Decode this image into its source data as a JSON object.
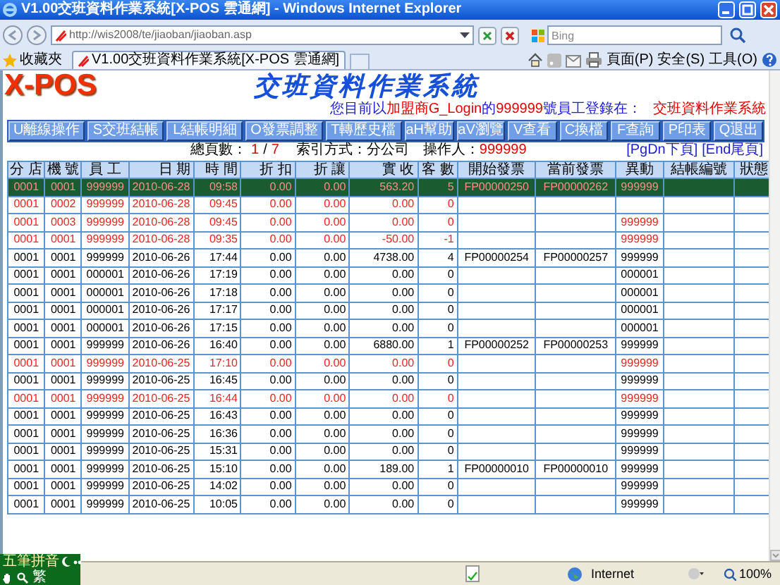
{
  "window": {
    "title": "V1.00交班資料作業系統[X-POS 雲通網] - Windows Internet Explorer"
  },
  "address_bar": {
    "url": "http://wis2008/te/jiaoban/jiaoban.asp",
    "search_placeholder": "Bing"
  },
  "favorites": {
    "label": "收藏夾"
  },
  "tab": {
    "title": "V1.00交班資料作業系統[X-POS 雲通網]",
    "selected": true
  },
  "command_bar": {
    "menus": [
      "頁面(P)",
      "安全(S)",
      "工具(O)"
    ]
  },
  "app": {
    "logo": "X-POS",
    "title": "交班資料作業系統",
    "login_notice": [
      {
        "text": "您目前以",
        "emphasis": false
      },
      {
        "text": "加盟商G_Login",
        "emphasis": true
      },
      {
        "text": "的",
        "emphasis": false
      },
      {
        "text": "999999",
        "emphasis": true
      },
      {
        "text": "號員工登錄在：",
        "emphasis": false
      }
    ],
    "current_system": "交班資料作業系統",
    "buttons": [
      "U離線操作",
      "S交班結帳",
      "L結帳明細",
      "O發票調整",
      "T轉歷史檔",
      "aH幫助",
      "aV瀏覽",
      "V查看",
      "C換檔",
      "F查詢",
      "P印表",
      "Q退出"
    ],
    "pager": {
      "label": "總頁數：",
      "current": "1",
      "separator": "/",
      "total": "7"
    },
    "index_mode": "索引方式：分公司",
    "operator": {
      "label": "操作人：",
      "value": "999999"
    },
    "links": [
      "[PgDn下頁]",
      "[End尾頁]"
    ]
  },
  "table": {
    "columns": [
      "分 店",
      "機 號",
      "員 工",
      "日 期",
      "時 間",
      "折 扣",
      "折 讓",
      "實 收",
      "客 數",
      "開始發票",
      "當前發票",
      "異動",
      "結帳編號",
      "狀態"
    ],
    "rows": [
      {
        "selected": true,
        "flagged": true,
        "store": "0001",
        "machine": "0001",
        "staff": "999999",
        "date": "2010-06-28",
        "time": "09:58",
        "discount": "0.00",
        "allowance": "0.00",
        "received": "563.20",
        "customers": "5",
        "start_invoice": "FP00000250",
        "current_invoice": "FP00000262",
        "change": "999999"
      },
      {
        "selected": false,
        "flagged": true,
        "store": "0001",
        "machine": "0002",
        "staff": "999999",
        "date": "2010-06-28",
        "time": "09:45",
        "discount": "0.00",
        "allowance": "0.00",
        "received": "0.00",
        "customers": "0"
      },
      {
        "selected": false,
        "flagged": true,
        "store": "0001",
        "machine": "0003",
        "staff": "999999",
        "date": "2010-06-28",
        "time": "09:45",
        "discount": "0.00",
        "allowance": "0.00",
        "received": "0.00",
        "customers": "0",
        "change": "999999"
      },
      {
        "selected": false,
        "flagged": true,
        "store": "0001",
        "machine": "0001",
        "staff": "999999",
        "date": "2010-06-28",
        "time": "09:35",
        "discount": "0.00",
        "allowance": "0.00",
        "received": "-50.00",
        "customers": "-1",
        "change": "999999"
      },
      {
        "selected": false,
        "flagged": false,
        "store": "0001",
        "machine": "0001",
        "staff": "999999",
        "date": "2010-06-26",
        "time": "17:44",
        "discount": "0.00",
        "allowance": "0.00",
        "received": "4738.00",
        "customers": "4",
        "start_invoice": "FP00000254",
        "current_invoice": "FP00000257",
        "change": "999999"
      },
      {
        "selected": false,
        "flagged": false,
        "store": "0001",
        "machine": "0001",
        "staff": "000001",
        "date": "2010-06-26",
        "time": "17:19",
        "discount": "0.00",
        "allowance": "0.00",
        "received": "0.00",
        "customers": "0",
        "change": "000001"
      },
      {
        "selected": false,
        "flagged": false,
        "store": "0001",
        "machine": "0001",
        "staff": "000001",
        "date": "2010-06-26",
        "time": "17:18",
        "discount": "0.00",
        "allowance": "0.00",
        "received": "0.00",
        "customers": "0",
        "change": "000001"
      },
      {
        "selected": false,
        "flagged": false,
        "store": "0001",
        "machine": "0001",
        "staff": "000001",
        "date": "2010-06-26",
        "time": "17:17",
        "discount": "0.00",
        "allowance": "0.00",
        "received": "0.00",
        "customers": "0",
        "change": "000001"
      },
      {
        "selected": false,
        "flagged": false,
        "store": "0001",
        "machine": "0001",
        "staff": "000001",
        "date": "2010-06-26",
        "time": "17:15",
        "discount": "0.00",
        "allowance": "0.00",
        "received": "0.00",
        "customers": "0",
        "change": "000001"
      },
      {
        "selected": false,
        "flagged": false,
        "store": "0001",
        "machine": "0001",
        "staff": "999999",
        "date": "2010-06-26",
        "time": "16:40",
        "discount": "0.00",
        "allowance": "0.00",
        "received": "6880.00",
        "customers": "1",
        "start_invoice": "FP00000252",
        "current_invoice": "FP00000253",
        "change": "999999"
      },
      {
        "selected": false,
        "flagged": true,
        "store": "0001",
        "machine": "0001",
        "staff": "999999",
        "date": "2010-06-25",
        "time": "17:10",
        "discount": "0.00",
        "allowance": "0.00",
        "received": "0.00",
        "customers": "0",
        "change": "999999"
      },
      {
        "selected": false,
        "flagged": false,
        "store": "0001",
        "machine": "0001",
        "staff": "999999",
        "date": "2010-06-25",
        "time": "16:45",
        "discount": "0.00",
        "allowance": "0.00",
        "received": "0.00",
        "customers": "0",
        "change": "999999"
      },
      {
        "selected": false,
        "flagged": true,
        "store": "0001",
        "machine": "0001",
        "staff": "999999",
        "date": "2010-06-25",
        "time": "16:44",
        "discount": "0.00",
        "allowance": "0.00",
        "received": "0.00",
        "customers": "0",
        "change": "999999"
      },
      {
        "selected": false,
        "flagged": false,
        "store": "0001",
        "machine": "0001",
        "staff": "999999",
        "date": "2010-06-25",
        "time": "16:43",
        "discount": "0.00",
        "allowance": "0.00",
        "received": "0.00",
        "customers": "0",
        "change": "999999"
      },
      {
        "selected": false,
        "flagged": false,
        "store": "0001",
        "machine": "0001",
        "staff": "999999",
        "date": "2010-06-25",
        "time": "16:36",
        "discount": "0.00",
        "allowance": "0.00",
        "received": "0.00",
        "customers": "0",
        "change": "999999"
      },
      {
        "selected": false,
        "flagged": false,
        "store": "0001",
        "machine": "0001",
        "staff": "999999",
        "date": "2010-06-25",
        "time": "15:31",
        "discount": "0.00",
        "allowance": "0.00",
        "received": "0.00",
        "customers": "0",
        "change": "999999"
      },
      {
        "selected": false,
        "flagged": false,
        "store": "0001",
        "machine": "0001",
        "staff": "999999",
        "date": "2010-06-25",
        "time": "15:10",
        "discount": "0.00",
        "allowance": "0.00",
        "received": "189.00",
        "customers": "1",
        "start_invoice": "FP00000010",
        "current_invoice": "FP00000010",
        "change": "999999"
      },
      {
        "selected": false,
        "flagged": false,
        "store": "0001",
        "machine": "0001",
        "staff": "999999",
        "date": "2010-06-25",
        "time": "14:02",
        "discount": "0.00",
        "allowance": "0.00",
        "received": "0.00",
        "customers": "0",
        "change": "999999"
      },
      {
        "selected": false,
        "flagged": false,
        "store": "0001",
        "machine": "0001",
        "staff": "999999",
        "date": "2010-06-25",
        "time": "10:05",
        "discount": "0.00",
        "allowance": "0.00",
        "received": "0.00",
        "customers": "0",
        "change": "999999"
      }
    ]
  },
  "status_bar": {
    "zone": "Internet",
    "zoom": "100%"
  },
  "ime_toolbar": {
    "input_method": "五筆拼音",
    "charset": "繁"
  }
}
